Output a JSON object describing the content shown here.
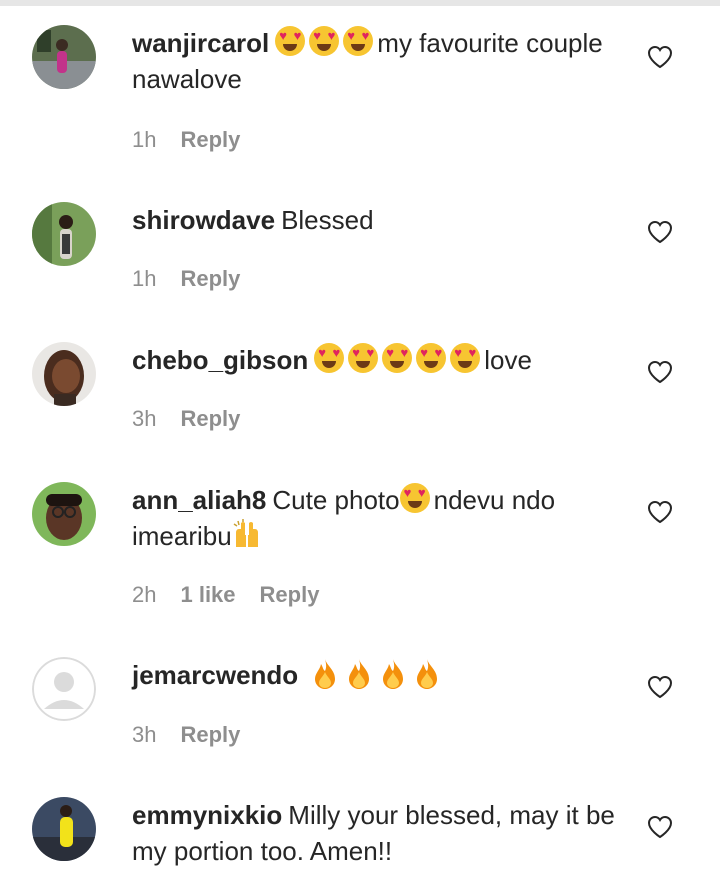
{
  "comments": [
    {
      "username": "wanjircarol",
      "text_after": "my favourite couple nawalove",
      "emoji_hearts": 3,
      "time": "1h",
      "likes": "",
      "reply": "Reply"
    },
    {
      "username": "shirowdave",
      "text_after": "Blessed",
      "time": "1h",
      "likes": "",
      "reply": "Reply"
    },
    {
      "username": "chebo_gibson",
      "text_after": "love",
      "emoji_hearts": 5,
      "time": "3h",
      "likes": "",
      "reply": "Reply"
    },
    {
      "username": "ann_aliah8",
      "text_before": "Cute photo",
      "text_after": "ndevu ndo imearibu",
      "time": "2h",
      "likes": "1 like",
      "reply": "Reply"
    },
    {
      "username": "jemarcwendo",
      "emoji_fire": 4,
      "time": "3h",
      "likes": "",
      "reply": "Reply"
    },
    {
      "username": "emmynixkio",
      "text_after": "Milly your blessed, may it be my portion too. Amen!!",
      "time": "",
      "likes": "",
      "reply": ""
    }
  ],
  "colors": {
    "text": "#262626",
    "meta": "#8e8e8e",
    "heart_outline": "#262626"
  },
  "icons": [
    "heart-outline-icon",
    "heart-eyes-emoji",
    "fire-emoji",
    "raising-hands-emoji"
  ]
}
